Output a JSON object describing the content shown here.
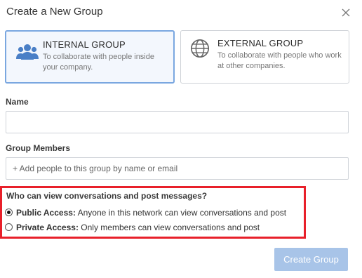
{
  "dialog": {
    "title": "Create a New Group",
    "close_icon": "close-icon"
  },
  "group_types": {
    "internal": {
      "title": "INTERNAL GROUP",
      "description": "To collaborate with people inside your company.",
      "icon": "people-icon",
      "selected": true
    },
    "external": {
      "title": "EXTERNAL GROUP",
      "description": "To collaborate with people who work at other companies.",
      "icon": "globe-icon",
      "selected": false
    }
  },
  "name_field": {
    "label": "Name",
    "value": ""
  },
  "members_field": {
    "label": "Group Members",
    "placeholder": "+ Add people to this group by name or email"
  },
  "access": {
    "question": "Who can view conversations and post messages?",
    "options": [
      {
        "label": "Public Access:",
        "description": "Anyone in this network can view conversations and post",
        "checked": true
      },
      {
        "label": "Private Access:",
        "description": "Only members can view conversations and post",
        "checked": false
      }
    ]
  },
  "actions": {
    "create_label": "Create Group"
  },
  "colors": {
    "accent": "#7aa7e0",
    "icon_blue": "#4a7fc6",
    "button_disabled": "#a8c4e8",
    "highlight": "#e8202a"
  }
}
